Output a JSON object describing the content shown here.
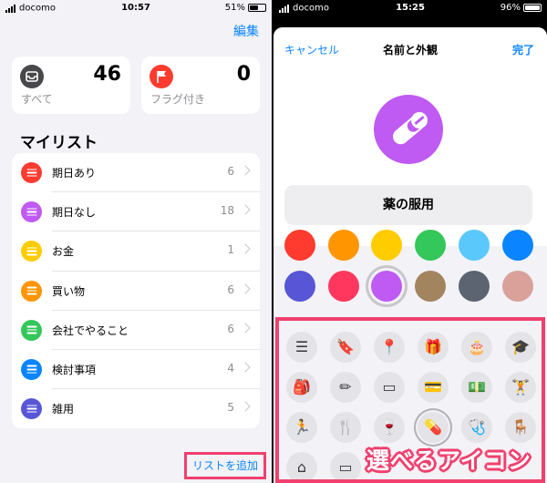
{
  "left": {
    "status": {
      "carrier": "docomo",
      "time": "10:57",
      "battery": "51%"
    },
    "edit_label": "編集",
    "cards": [
      {
        "count": "46",
        "label": "すべて",
        "icon": "tray-icon",
        "color": "#48484a"
      },
      {
        "count": "0",
        "label": "フラグ付き",
        "icon": "flag-icon",
        "color": "#ff3b30"
      }
    ],
    "my_lists_title": "マイリスト",
    "lists": [
      {
        "name": "期日あり",
        "count": "6",
        "color": "#ff3b30"
      },
      {
        "name": "期日なし",
        "count": "18",
        "color": "#bf5af2"
      },
      {
        "name": "お金",
        "count": "1",
        "color": "#ffcc00"
      },
      {
        "name": "買い物",
        "count": "6",
        "color": "#ff9500"
      },
      {
        "name": "会社でやること",
        "count": "6",
        "color": "#34c759"
      },
      {
        "name": "検討事項",
        "count": "4",
        "color": "#0a84ff"
      },
      {
        "name": "雑用",
        "count": "5",
        "color": "#5856d6"
      }
    ],
    "add_list_label": "リストを追加"
  },
  "right": {
    "status": {
      "carrier": "docomo",
      "time": "15:25",
      "battery": "96%"
    },
    "cancel_label": "キャンセル",
    "title": "名前と外観",
    "done_label": "完了",
    "selected_icon": "pill-icon",
    "selected_color": "#bf5af2",
    "list_name": "薬の服用",
    "colors_row1": [
      "#ff3b30",
      "#ff9500",
      "#ffcc00",
      "#34c759",
      "#5ac8fa",
      "#0a84ff"
    ],
    "colors_row2": [
      "#5856d6",
      "#ff375f",
      "#bf5af2",
      "#a2845e",
      "#5b6470",
      "#d9a19a"
    ],
    "selected_color_index": 2,
    "icons": [
      {
        "name": "list-icon",
        "glyph": "☰"
      },
      {
        "name": "bookmark-icon",
        "glyph": "🔖"
      },
      {
        "name": "pin-icon",
        "glyph": "📍"
      },
      {
        "name": "gift-icon",
        "glyph": "🎁"
      },
      {
        "name": "cake-icon",
        "glyph": "🎂"
      },
      {
        "name": "graduation-cap-icon",
        "glyph": "🎓"
      },
      {
        "name": "backpack-icon",
        "glyph": "🎒"
      },
      {
        "name": "ruler-pencil-icon",
        "glyph": "✏"
      },
      {
        "name": "wallet-icon",
        "glyph": "▭"
      },
      {
        "name": "credit-card-icon",
        "glyph": "💳"
      },
      {
        "name": "money-icon",
        "glyph": "💵"
      },
      {
        "name": "dumbbell-icon",
        "glyph": "🏋"
      },
      {
        "name": "running-icon",
        "glyph": "🏃"
      },
      {
        "name": "fork-knife-icon",
        "glyph": "🍴"
      },
      {
        "name": "wine-glass-icon",
        "glyph": "🍷"
      },
      {
        "name": "pill-icon",
        "glyph": "💊"
      },
      {
        "name": "stethoscope-icon",
        "glyph": "🩺"
      },
      {
        "name": "chair-icon",
        "glyph": "🪑"
      },
      {
        "name": "house-icon",
        "glyph": "⌂"
      },
      {
        "name": "tv-icon",
        "glyph": "▭"
      }
    ],
    "selected_icon_index": 15,
    "overlay_caption": "選べるアイコン"
  }
}
